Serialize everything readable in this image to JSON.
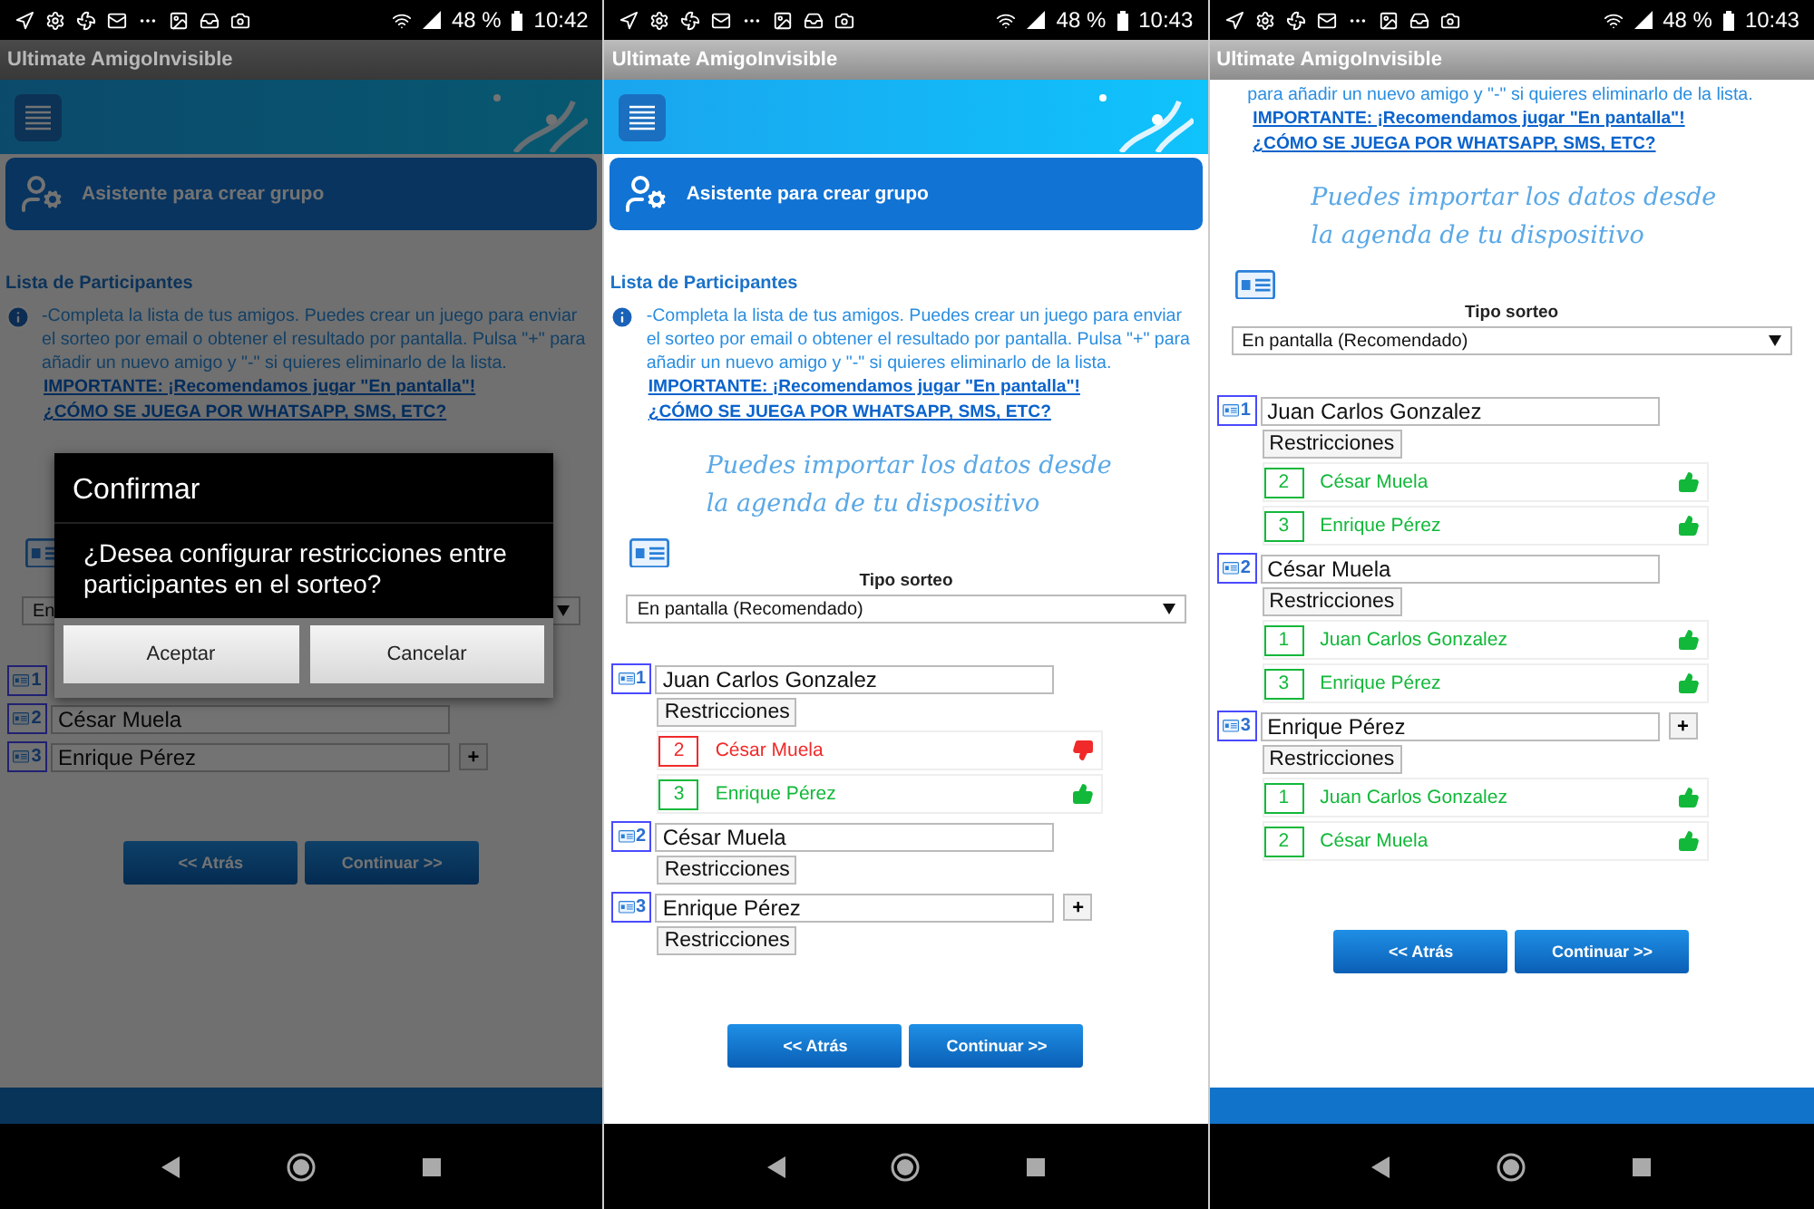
{
  "screens": [
    {
      "time": "10:42",
      "battery": "48 %",
      "app_title": "Ultimate AmigoInvisible",
      "dimmed": true,
      "footer_bar": true,
      "wizard_title": "Asistente para crear grupo",
      "section_title": "Lista de Participantes",
      "info": "-Completa la lista de tus amigos. Puedes crear un juego para enviar el sorteo por email o obtener el resultado por pantalla. Pulsa \"+\" para añadir un nuevo amigo y \"-\" si quieres eliminarlo de la lista.",
      "links": [
        "IMPORTANTE: ¡Recomendamos jugar \"En pantalla\"!",
        "¿CÓMO SE JUEGA POR WHATSAPP, SMS, ETC?"
      ],
      "draw_type": {
        "value": "En"
      },
      "participants": [
        {
          "number": "1"
        },
        {
          "number": "2",
          "name": "César Muela"
        },
        {
          "number": "3",
          "name": "Enrique Pérez",
          "add_button": "+"
        }
      ],
      "nav_buttons": [
        "<< Atrás",
        "Continuar >>"
      ],
      "dialog": {
        "title": "Confirmar",
        "message": "¿Desea configurar restricciones entre participantes en el sorteo?",
        "buttons": [
          "Aceptar",
          "Cancelar"
        ]
      }
    },
    {
      "time": "10:43",
      "battery": "48 %",
      "app_title": "Ultimate AmigoInvisible",
      "dimmed": false,
      "footer_bar": false,
      "wizard_title": "Asistente para crear grupo",
      "section_title": "Lista de Participantes",
      "info": "-Completa la lista de tus amigos. Puedes crear un juego para enviar el sorteo por email o obtener el resultado por pantalla. Pulsa \"+\" para añadir un nuevo amigo y \"-\" si quieres eliminarlo de la lista.",
      "links": [
        "IMPORTANTE: ¡Recomendamos jugar \"En pantalla\"!",
        "¿CÓMO SE JUEGA POR WHATSAPP, SMS, ETC?"
      ],
      "import_hint": "Puedes importar los datos desde la agenda de tu dispositivo",
      "draw_type": {
        "label": "Tipo sorteo",
        "value": "En pantalla (Recomendado)"
      },
      "participants": [
        {
          "number": "1",
          "name": "Juan Carlos Gonzalez",
          "restrictions_label": "Restricciones",
          "restrictions": [
            {
              "number": "2",
              "name": "César Muela",
              "allowed": false
            },
            {
              "number": "3",
              "name": "Enrique Pérez",
              "allowed": true
            }
          ]
        },
        {
          "number": "2",
          "name": "César Muela",
          "restrictions_label": "Restricciones"
        },
        {
          "number": "3",
          "name": "Enrique Pérez",
          "add_button": "+",
          "restrictions_label": "Restricciones"
        }
      ],
      "nav_buttons": [
        "<< Atrás",
        "Continuar >>"
      ]
    },
    {
      "time": "10:43",
      "battery": "48 %",
      "app_title": "Ultimate AmigoInvisible",
      "dimmed": false,
      "footer_bar": true,
      "info": "para añadir un nuevo amigo y \"-\" si quieres eliminarlo de la lista.",
      "links": [
        "IMPORTANTE: ¡Recomendamos jugar \"En pantalla\"!",
        "¿CÓMO SE JUEGA POR WHATSAPP, SMS, ETC?"
      ],
      "import_hint": "Puedes importar los datos desde la agenda de tu dispositivo",
      "draw_type": {
        "label": "Tipo sorteo",
        "value": "En pantalla (Recomendado)"
      },
      "participants": [
        {
          "number": "1",
          "name": "Juan Carlos Gonzalez",
          "restrictions_label": "Restricciones",
          "restrictions": [
            {
              "number": "2",
              "name": "César Muela",
              "allowed": true
            },
            {
              "number": "3",
              "name": "Enrique Pérez",
              "allowed": true
            }
          ]
        },
        {
          "number": "2",
          "name": "César Muela",
          "restrictions_label": "Restricciones",
          "restrictions": [
            {
              "number": "1",
              "name": "Juan Carlos Gonzalez",
              "allowed": true
            },
            {
              "number": "3",
              "name": "Enrique Pérez",
              "allowed": true
            }
          ]
        },
        {
          "number": "3",
          "name": "Enrique Pérez",
          "add_button": "+",
          "restrictions_label": "Restricciones",
          "restrictions": [
            {
              "number": "1",
              "name": "Juan Carlos Gonzalez",
              "allowed": true
            },
            {
              "number": "2",
              "name": "César Muela",
              "allowed": true
            }
          ]
        }
      ],
      "nav_buttons": [
        "<< Atrás",
        "Continuar >>"
      ]
    }
  ]
}
